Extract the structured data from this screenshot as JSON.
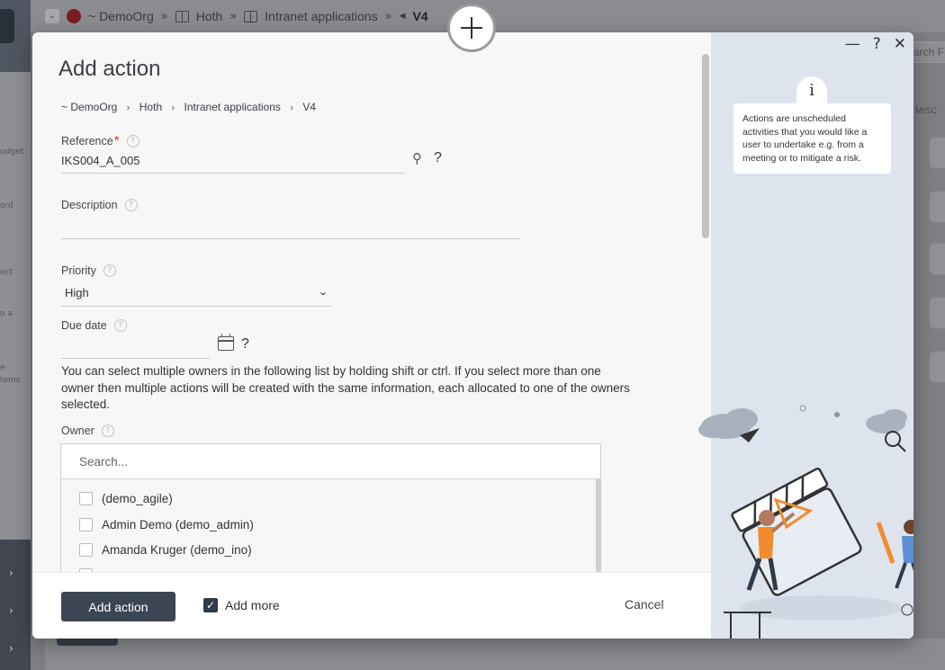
{
  "background": {
    "breadcrumbs": [
      {
        "label": "~ DemoOrg"
      },
      {
        "label": "Hoth"
      },
      {
        "label": "Intranet applications"
      },
      {
        "label": "V4"
      }
    ],
    "search_placeholder": "arch F",
    "misc_label": "MISC",
    "side_labels": [
      "udget",
      "ord",
      "ect",
      "o a",
      "e",
      "tems"
    ]
  },
  "modal": {
    "title": "Add action",
    "breadcrumb": [
      "~ DemoOrg",
      "Hoth",
      "Intranet applications",
      "V4"
    ],
    "fields": {
      "reference": {
        "label": "Reference",
        "value": "IKS004_A_005",
        "required": true
      },
      "description": {
        "label": "Description",
        "value": ""
      },
      "priority": {
        "label": "Priority",
        "value": "High"
      },
      "due_date": {
        "label": "Due date",
        "value": ""
      }
    },
    "owner_info": "You can select multiple owners in the following list by holding shift or ctrl. If you select more than one owner then multiple actions will be created with the same information, each allocated to one of the owners selected.",
    "owner": {
      "label": "Owner",
      "search_placeholder": "Search...",
      "items": [
        {
          "label": "(demo_agile)",
          "checked": false
        },
        {
          "label": "Admin Demo (demo_admin)",
          "checked": false
        },
        {
          "label": "Amanda Kruger (demo_ino)",
          "checked": false
        }
      ]
    },
    "footer": {
      "submit_label": "Add action",
      "add_more_label": "Add more",
      "add_more_checked": true,
      "cancel_label": "Cancel"
    },
    "side_panel": {
      "info_text": "Actions are unscheduled activities that you would like a user to undertake e.g. from a meeting or to mitigate a risk."
    },
    "window_controls": {
      "help": "?"
    }
  },
  "colors": {
    "primary_button": "#3b4554",
    "required": "#d83a3a",
    "side_panel": "#dde4ee"
  }
}
